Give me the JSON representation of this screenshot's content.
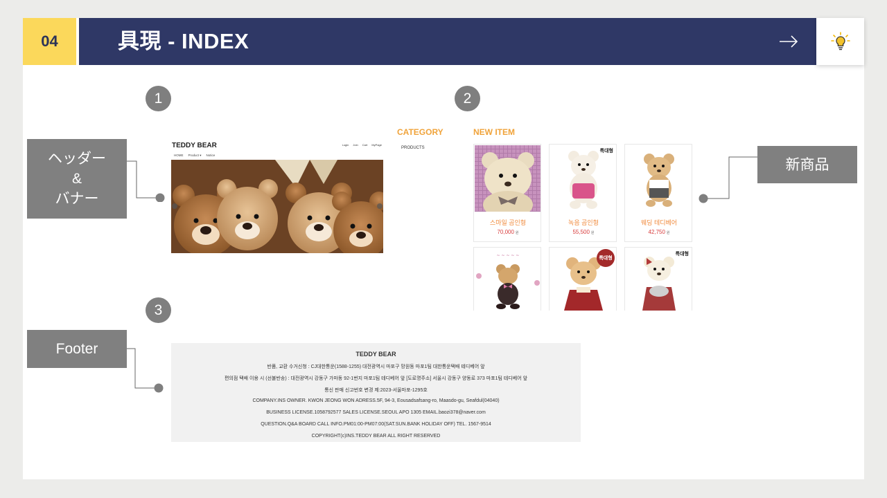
{
  "header": {
    "number": "04",
    "title": "具現 - INDEX",
    "arrow_icon": "arrow-right-icon",
    "bulb_icon": "lightbulb-icon"
  },
  "colors": {
    "accent_yellow": "#fbd85b",
    "navy": "#2f3866",
    "label_gray": "#808080",
    "orange": "#f0a33a",
    "price_red": "#d83c3c"
  },
  "markers": [
    "1",
    "2",
    "3"
  ],
  "labels": {
    "header_banner": [
      "ヘッダー",
      "&",
      "バナー"
    ],
    "new_item": "新商品",
    "footer": "Footer"
  },
  "mock_header": {
    "logo": "TEDDY BEAR",
    "util_links": [
      "Login",
      "Join",
      "Cart",
      "MyPage"
    ],
    "nav": [
      "HOME",
      "Product ▾",
      "Notice"
    ]
  },
  "category": {
    "title": "CATEGORY",
    "items": [
      "PRODUCTS"
    ]
  },
  "new_item": {
    "title": "NEW ITEM",
    "products": [
      {
        "name": "스마일 곰인형",
        "price": "70,000",
        "unit": "원",
        "tag": ""
      },
      {
        "name": "녹음 곰인형",
        "price": "55,500",
        "unit": "원",
        "tag": "특대형"
      },
      {
        "name": "웨딩 테디베어",
        "price": "42,750",
        "unit": "원",
        "tag": ""
      },
      {
        "name": "",
        "price": "",
        "unit": "",
        "tag": ""
      },
      {
        "name": "",
        "price": "",
        "unit": "",
        "tag": "특대형"
      },
      {
        "name": "",
        "price": "",
        "unit": "",
        "tag": "특대형"
      }
    ]
  },
  "footer_mock": {
    "title": "TEDDY BEAR",
    "lines": [
      "반품, 교환 수거신청 : CJ대한통운(1588-1255) 대전광역시 마포구 망원동 마포1팀 대한통운택배 테디베어 앞",
      "편의점 택배 이용 시 (선불반송) : 대전광역시 강동구 가마동 92-1번지 마포1팀 테디베어 앞 [도로명주소] 서울시 강동구 양동로 373 마포1팀 테디베어 앞",
      "통신 판매 신고번호 변경 제:2023-서울마포-1295호",
      "COMPANY.INS OWNER. KWON JEONG WON ADRESS.5F, 94-3, Eousadsafsang-ro, Maasdo-gu, Seafdul(04040)",
      "BUSINESS LICENSE.1058792577 SALES LICENSE.SEOUL APO 1305 EMAIL.baozi378@naver.com",
      "QUESTION.Q&A BOARD CALL INFO.PM01:00-PM07:00(SAT.SUN.BANK HOLIDAY OFF) TEL. 1567-9514",
      "COPYRIGHT(c)INS.TEDDY BEAR ALL RIGHT RESERVED"
    ]
  }
}
